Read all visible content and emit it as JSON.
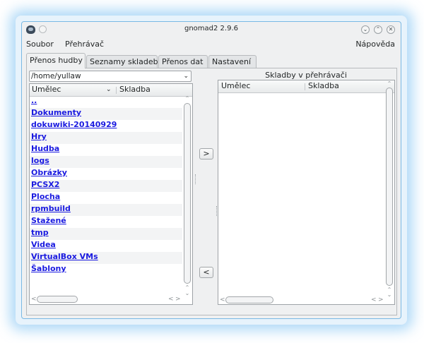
{
  "window": {
    "title": "gnomad2 2.9.6",
    "controls": [
      "minimize",
      "maximize",
      "close"
    ]
  },
  "menubar": {
    "left": [
      "Soubor",
      "Přehrávač"
    ],
    "right": "Nápověda"
  },
  "tabs": [
    "Přenos hudby",
    "Seznamy skladeb",
    "Přenos dat",
    "Nastavení"
  ],
  "active_tab": "Přenos hudby",
  "left_pane": {
    "path": "/home/yullaw",
    "columns": [
      "Umělec",
      "Skladba"
    ],
    "rows": [
      "..",
      "Dokumenty",
      "dokuwiki-20140929",
      "Hry",
      "Hudba",
      "logs",
      "Obrázky",
      "PCSX2",
      "Plocha",
      "rpmbuild",
      "Stažené",
      "tmp",
      "Videa",
      "VirtualBox VMs",
      "Šablony"
    ]
  },
  "transfer": {
    "to_player": ">",
    "from_player": "<"
  },
  "right_pane": {
    "title": "Skladby v přehrávači",
    "columns": [
      "Umělec",
      "Skladba"
    ],
    "rows": []
  }
}
